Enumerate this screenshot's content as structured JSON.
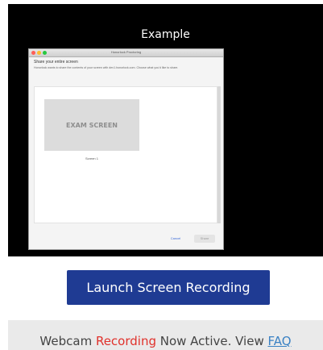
{
  "example": {
    "title": "Example",
    "dialog": {
      "window_title": "Honorlock Proctoring",
      "heading": "Share your entire screen",
      "description": "Honorlock wants to share the contents of your screen with dev1.honorlock.com. Choose what you'd like to share.",
      "screen_thumbnail_text": "EXAM SCREEN",
      "screen_label": "Screen 1",
      "cancel_label": "Cancel",
      "share_label": "Share"
    }
  },
  "launch_button": {
    "label": "Launch Screen Recording"
  },
  "status": {
    "prefix": "Webcam ",
    "recording": "Recording",
    "middle": " Now Active. View ",
    "link": "FAQ"
  },
  "colors": {
    "button_bg": "#1f3b93",
    "recording_red": "#e0312b",
    "link_blue": "#3b82c4",
    "status_bar_bg": "#eaeaea"
  }
}
